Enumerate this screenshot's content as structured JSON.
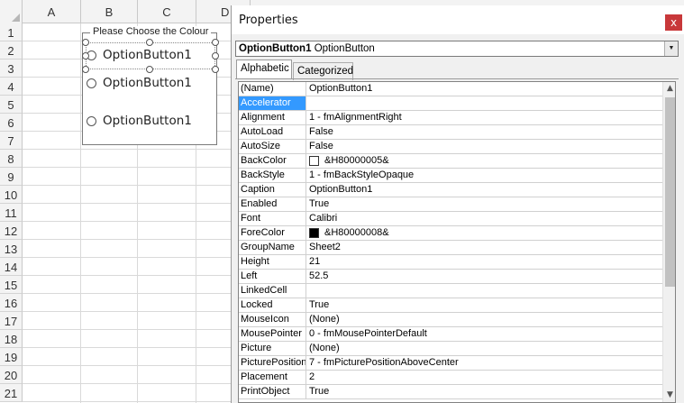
{
  "sheet": {
    "columns": [
      "A",
      "B",
      "C",
      "D"
    ],
    "rows": [
      "1",
      "2",
      "3",
      "4",
      "5",
      "6",
      "7",
      "8",
      "9",
      "10",
      "11",
      "12",
      "13",
      "14",
      "15",
      "16",
      "17",
      "18",
      "19",
      "20",
      "21"
    ]
  },
  "frame": {
    "caption": "Please Choose the Colour",
    "options": [
      "OptionButton1",
      "OptionButton1",
      "OptionButton1"
    ]
  },
  "properties_window": {
    "title": "Properties",
    "close_glyph": "x",
    "object_name": "OptionButton1",
    "object_type": "OptionButton",
    "tabs": [
      "Alphabetic",
      "Categorized"
    ],
    "active_tab": "Alphabetic",
    "selected_property": "Accelerator",
    "rows": [
      {
        "name": "(Name)",
        "value": "OptionButton1"
      },
      {
        "name": "Accelerator",
        "value": ""
      },
      {
        "name": "Alignment",
        "value": "1 - fmAlignmentRight"
      },
      {
        "name": "AutoLoad",
        "value": "False"
      },
      {
        "name": "AutoSize",
        "value": "False"
      },
      {
        "name": "BackColor",
        "value": "&H80000005&",
        "swatch": "#ffffff"
      },
      {
        "name": "BackStyle",
        "value": "1 - fmBackStyleOpaque"
      },
      {
        "name": "Caption",
        "value": "OptionButton1"
      },
      {
        "name": "Enabled",
        "value": "True"
      },
      {
        "name": "Font",
        "value": "Calibri"
      },
      {
        "name": "ForeColor",
        "value": "&H80000008&",
        "swatch": "#000000"
      },
      {
        "name": "GroupName",
        "value": "Sheet2"
      },
      {
        "name": "Height",
        "value": "21"
      },
      {
        "name": "Left",
        "value": "52.5"
      },
      {
        "name": "LinkedCell",
        "value": ""
      },
      {
        "name": "Locked",
        "value": "True"
      },
      {
        "name": "MouseIcon",
        "value": "(None)"
      },
      {
        "name": "MousePointer",
        "value": "0 - fmMousePointerDefault"
      },
      {
        "name": "Picture",
        "value": "(None)"
      },
      {
        "name": "PicturePosition",
        "value": "7 - fmPicturePositionAboveCenter"
      },
      {
        "name": "Placement",
        "value": "2"
      },
      {
        "name": "PrintObject",
        "value": "True"
      }
    ]
  },
  "colors": {
    "selection": "#3399ff",
    "close_button": "#c8383a"
  }
}
